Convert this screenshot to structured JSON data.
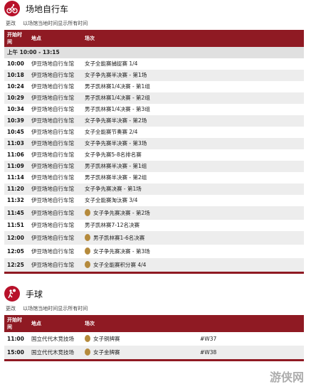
{
  "track": {
    "title": "场地自行车",
    "tz_change": "更改",
    "tz_note": "以场馆当地时间显示所有时间",
    "col_time": "开始时间",
    "col_venue": "地点",
    "col_event": "场次",
    "session": "上午  10:00 - 13:15",
    "rows": [
      {
        "time": "10:00",
        "venue": "伊豆场地自行车馆",
        "event": "女子全能赛捕捉赛 1/4",
        "medal": false
      },
      {
        "time": "10:18",
        "venue": "伊豆场地自行车馆",
        "event": "女子争先赛半决赛 - 第1场",
        "medal": false
      },
      {
        "time": "10:24",
        "venue": "伊豆场地自行车馆",
        "event": "男子凯林赛1/4决赛 - 第1组",
        "medal": false
      },
      {
        "time": "10:29",
        "venue": "伊豆场地自行车馆",
        "event": "男子凯林赛1/4决赛 - 第2组",
        "medal": false
      },
      {
        "time": "10:34",
        "venue": "伊豆场地自行车馆",
        "event": "男子凯林赛1/4决赛 - 第3组",
        "medal": false
      },
      {
        "time": "10:39",
        "venue": "伊豆场地自行车馆",
        "event": "女子争先赛半决赛 - 第2场",
        "medal": false
      },
      {
        "time": "10:45",
        "venue": "伊豆场地自行车馆",
        "event": "女子全能赛节奏赛 2/4",
        "medal": false
      },
      {
        "time": "11:03",
        "venue": "伊豆场地自行车馆",
        "event": "女子争先赛半决赛 - 第3场",
        "medal": false
      },
      {
        "time": "11:06",
        "venue": "伊豆场地自行车馆",
        "event": "女子争先赛5-8名排名赛",
        "medal": false
      },
      {
        "time": "11:09",
        "venue": "伊豆场地自行车馆",
        "event": "男子凯林赛半决赛 - 第1组",
        "medal": false
      },
      {
        "time": "11:14",
        "venue": "伊豆场地自行车馆",
        "event": "男子凯林赛半决赛 - 第2组",
        "medal": false
      },
      {
        "time": "11:20",
        "venue": "伊豆场地自行车馆",
        "event": "女子争先赛决赛 - 第1场",
        "medal": false
      },
      {
        "time": "11:32",
        "venue": "伊豆场地自行车馆",
        "event": "女子全能赛淘汰赛 3/4",
        "medal": false
      },
      {
        "time": "11:45",
        "venue": "伊豆场地自行车馆",
        "event": "女子争先赛决赛 - 第2场",
        "medal": true
      },
      {
        "time": "11:51",
        "venue": "伊豆场地自行车馆",
        "event": "男子凯林赛7-12名决赛",
        "medal": false
      },
      {
        "time": "12:00",
        "venue": "伊豆场地自行车馆",
        "event": "男子凯林赛1-6名决赛",
        "medal": true
      },
      {
        "time": "12:05",
        "venue": "伊豆场地自行车馆",
        "event": "女子争先赛决赛 - 第3场",
        "medal": true
      },
      {
        "time": "12:25",
        "venue": "伊豆场地自行车馆",
        "event": "女子全能赛积分赛 4/4",
        "medal": true
      }
    ]
  },
  "handball": {
    "title": "手球",
    "tz_change": "更改",
    "tz_note": "以场馆当地时间显示所有时间",
    "col_time": "开始时间",
    "col_venue": "地点",
    "col_event": "场次",
    "rows": [
      {
        "time": "11:00",
        "venue": "国立代代木竞技场",
        "event": "女子铜牌赛",
        "code": "#W37",
        "medal": true
      },
      {
        "time": "15:00",
        "venue": "国立代代木竞技场",
        "event": "女子金牌赛",
        "code": "#W38",
        "medal": true
      }
    ]
  },
  "watermark": "游侠网",
  "colors": {
    "brand": "#b8112a",
    "header": "#8f1a23",
    "medal": "#b58a3c"
  }
}
